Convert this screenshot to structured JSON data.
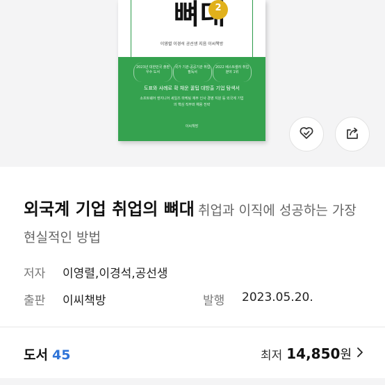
{
  "book_cover": {
    "title_text": "뼈대",
    "edition": "2",
    "authors_line": "이영렬 이경석 공선생 지음 이씨책방",
    "awards": [
      "2023년 대한민국 출판 우수 도서",
      "국가 기관·공공기관 취업 필독서",
      "2022 베스트셀러 취업 분야 1위"
    ],
    "subtitle": "도표와 사례로 확 채운 꿀팁 대방출 기업 탐색서",
    "description": "소프트웨어 엔지니어 세일즈 마케팅 재무 인사 경영 지원 등 외국계 기업의 핵심 직무와 채용 전략",
    "publisher_mark": "이씨책방"
  },
  "actions": {
    "like_icon": "heart-check-icon",
    "share_icon": "share-icon"
  },
  "title": {
    "main": "외국계 기업 취업의 뼈대",
    "sub": "취업과 이직에 성공하는 가장 현실적인 방법"
  },
  "meta": {
    "author_label": "저자",
    "author_value": "이영렬,이경석,공선생",
    "publisher_label": "출판",
    "publisher_value": "이씨책방",
    "date_label": "발행",
    "date_value": "2023.05.20."
  },
  "footer": {
    "category_label": "도서",
    "category_count": "45",
    "price_label": "최저",
    "price_value": "14,850",
    "price_unit": "원"
  },
  "colors": {
    "cover_green": "#35a24f",
    "badge_gold": "#e1b11c",
    "count_blue": "#2f74d8"
  }
}
